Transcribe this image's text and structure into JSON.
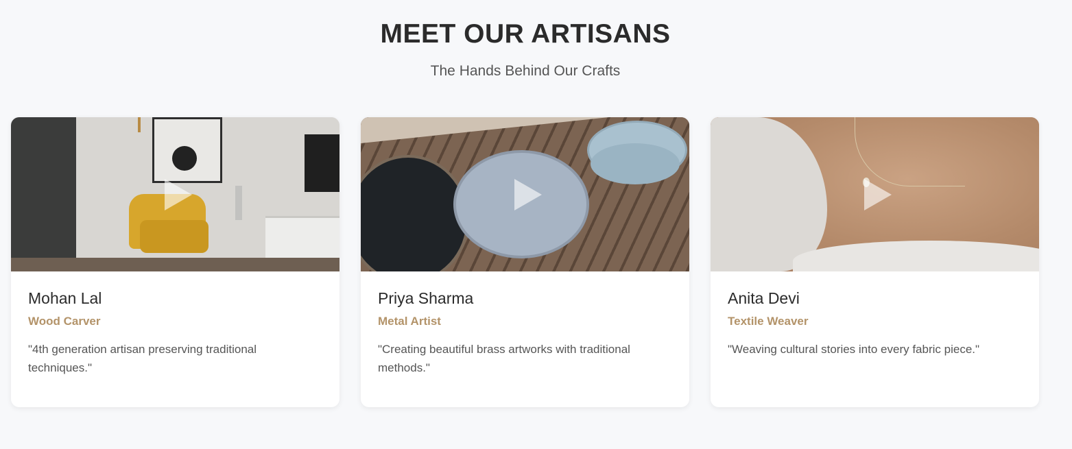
{
  "section": {
    "title": "MEET OUR ARTISANS",
    "subtitle": "The Hands Behind Our Crafts"
  },
  "artisans": [
    {
      "name": "Mohan Lal",
      "role": "Wood Carver",
      "quote": "\"4th generation artisan preserving traditional techniques.\"",
      "media_icon": "play-icon"
    },
    {
      "name": "Priya Sharma",
      "role": "Metal Artist",
      "quote": "\"Creating beautiful brass artworks with traditional methods.\"",
      "media_icon": "play-icon"
    },
    {
      "name": "Anita Devi",
      "role": "Textile Weaver",
      "quote": "\"Weaving cultural stories into every fabric piece.\"",
      "media_icon": "play-icon"
    }
  ],
  "colors": {
    "background": "#f7f8fa",
    "heading": "#2b2b2b",
    "role_accent": "#b39369",
    "card": "#ffffff"
  }
}
